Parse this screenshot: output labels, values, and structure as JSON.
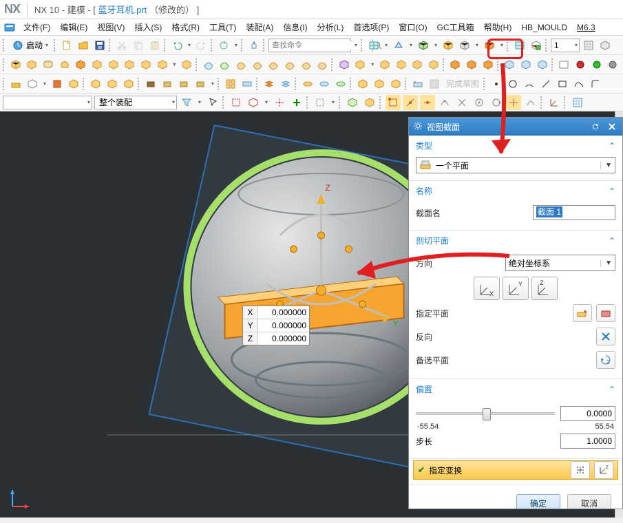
{
  "title": {
    "app": "NX 10",
    "mode": "建模",
    "doc": "蓝牙耳机.prt",
    "modified": "（修改的）"
  },
  "menu": {
    "file": "文件(F)",
    "edit": "编辑(E)",
    "view": "视图(V)",
    "insert": "插入(S)",
    "format": "格式(R)",
    "tools": "工具(T)",
    "assy": "装配(A)",
    "info": "信息(I)",
    "analyze": "分析(L)",
    "pref": "首选项(P)",
    "window": "窗口(O)",
    "gc": "GC工具箱",
    "help": "帮助(H)",
    "hb": "HB_MOULD",
    "m63": "M6.3"
  },
  "toolbar": {
    "startup_label": "启动",
    "search_placeholder": "查找命令",
    "window_num": "1",
    "finish_sketch": "完成草图"
  },
  "filter": {
    "empty": "",
    "assy_label": "整个装配"
  },
  "coord": {
    "x_label": "X",
    "x": "0.000000",
    "y_label": "Y",
    "y": "0.000000",
    "z_label": "Z",
    "z": "0.000000"
  },
  "panel": {
    "title": "视图截面",
    "type_head": "类型",
    "type_value": "一个平面",
    "name_head": "名称",
    "name_label": "截面名",
    "name_value": "截面 1",
    "cut_head": "剖切平面",
    "orient_label": "方向",
    "orient_value": "绝对坐标系",
    "axis_x": "X",
    "axis_y": "Y",
    "axis_z": "Z",
    "plane_label": "指定平面",
    "reverse_label": "反向",
    "alt_label": "备选平面",
    "offset_head": "偏置",
    "offset_value": "0.0000",
    "offset_min": "-55.54",
    "offset_max": "55.54",
    "step_label": "步长",
    "step_value": "1.0000",
    "transform_label": "指定变换",
    "ok": "确定",
    "cancel": "取消"
  }
}
